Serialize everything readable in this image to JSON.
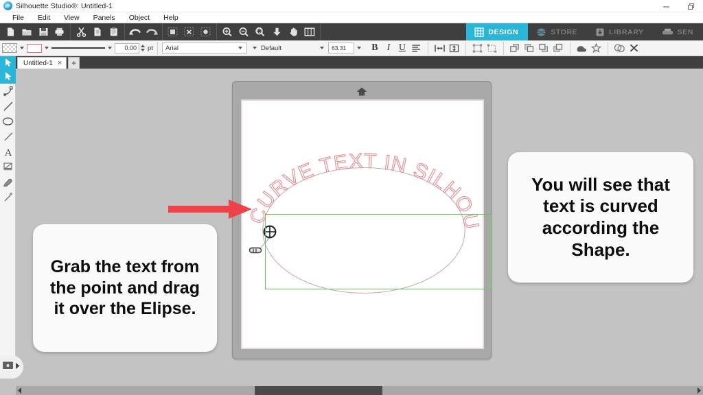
{
  "window": {
    "title": "Silhouette Studio®: Untitled-1",
    "logo_icon": "silhouette-logo-icon",
    "controls": [
      {
        "name": "minimize-button",
        "icon": "minimize-icon"
      },
      {
        "name": "restore-button",
        "icon": "restore-icon"
      }
    ]
  },
  "menubar": {
    "items": [
      {
        "label": "File"
      },
      {
        "label": "Edit"
      },
      {
        "label": "View"
      },
      {
        "label": "Panels"
      },
      {
        "label": "Object"
      },
      {
        "label": "Help"
      }
    ]
  },
  "toolbar_main": {
    "groups": [
      {
        "buttons": [
          {
            "name": "new-document-button",
            "icon": "new-file-icon"
          },
          {
            "name": "open-document-button",
            "icon": "folder-open-icon"
          },
          {
            "name": "save-button",
            "icon": "save-disk-icon"
          },
          {
            "name": "print-button",
            "icon": "printer-icon"
          }
        ]
      },
      {
        "buttons": [
          {
            "name": "cut-button",
            "icon": "scissors-icon"
          },
          {
            "name": "copy-button",
            "icon": "copy-icon"
          },
          {
            "name": "paste-button",
            "icon": "clipboard-icon"
          }
        ]
      },
      {
        "buttons": [
          {
            "name": "undo-button",
            "icon": "undo-arrow-icon"
          },
          {
            "name": "redo-button",
            "icon": "redo-arrow-icon"
          }
        ]
      },
      {
        "buttons": [
          {
            "name": "select-all-button",
            "icon": "select-all-icon"
          },
          {
            "name": "deselect-all-button",
            "icon": "deselect-all-icon"
          },
          {
            "name": "select-same-button",
            "icon": "select-same-icon"
          }
        ]
      },
      {
        "buttons": [
          {
            "name": "zoom-in-button",
            "icon": "zoom-in-icon"
          },
          {
            "name": "zoom-out-button",
            "icon": "zoom-out-icon"
          },
          {
            "name": "zoom-selection-button",
            "icon": "zoom-region-icon"
          },
          {
            "name": "fit-to-page-button",
            "icon": "fit-page-icon"
          },
          {
            "name": "pan-button",
            "icon": "hand-pan-icon"
          },
          {
            "name": "fit-to-window-button",
            "icon": "fit-window-icon"
          }
        ]
      }
    ],
    "mode_tabs": [
      {
        "label": "DESIGN",
        "icon": "grid-design-icon",
        "active": true
      },
      {
        "label": "STORE",
        "icon": "store-globe-icon",
        "active": false
      },
      {
        "label": "LIBRARY",
        "icon": "library-download-icon",
        "active": false
      },
      {
        "label": "SEN",
        "icon": "send-cutter-icon",
        "active": false
      }
    ],
    "accent_color": "#29b6d8",
    "background_color": "#3f3f3f"
  },
  "toolbar_secondary": {
    "fill_swatch": {
      "name": "fill-color-swatch",
      "icon": "transparent-checker-icon"
    },
    "line_swatch": {
      "name": "line-color-swatch",
      "color": "#ef6e80"
    },
    "line_style": {
      "name": "line-style-preview",
      "icon": "solid-line-icon"
    },
    "line_thickness": {
      "value": "0.00",
      "unit": "pt"
    },
    "font_family": {
      "value": "Arial"
    },
    "font_style": {
      "value": "Default"
    },
    "font_size": {
      "value": "63.31"
    },
    "text_buttons": [
      {
        "name": "bold-button",
        "label": "B"
      },
      {
        "name": "italic-button",
        "label": "I"
      },
      {
        "name": "underline-button",
        "label": "U"
      },
      {
        "name": "text-align-button",
        "icon": "align-left-icon"
      },
      {
        "name": "character-spacing-button",
        "icon": "character-spacing-icon"
      },
      {
        "name": "line-spacing-button",
        "icon": "line-spacing-icon"
      }
    ],
    "object_buttons": [
      {
        "name": "group-button",
        "icon": "group-icon"
      },
      {
        "name": "ungroup-button",
        "icon": "ungroup-icon"
      },
      {
        "name": "bring-to-front-button",
        "icon": "bring-to-front-icon"
      },
      {
        "name": "bring-forward-button",
        "icon": "bring-forward-icon"
      },
      {
        "name": "send-backward-button",
        "icon": "send-backward-icon"
      },
      {
        "name": "send-to-back-button",
        "icon": "send-to-back-icon"
      },
      {
        "name": "weld-button",
        "icon": "weld-icon"
      },
      {
        "name": "detach-lines-button",
        "icon": "star-detach-icon"
      },
      {
        "name": "offset-button",
        "icon": "offset-shapes-icon"
      },
      {
        "name": "delete-button",
        "icon": "close-x-icon"
      }
    ]
  },
  "tabstrip": {
    "active_tool_icon": "cursor-arrow-icon",
    "documents": [
      {
        "name": "Untitled-1",
        "close_label": "×"
      }
    ],
    "add_tab_label": "+"
  },
  "toolrail": {
    "tools": [
      {
        "name": "select-tool",
        "icon": "cursor-arrow-icon",
        "selected": true
      },
      {
        "name": "edit-points-tool",
        "icon": "edit-points-icon",
        "selected": false
      },
      {
        "name": "line-tool",
        "icon": "line-icon",
        "selected": false
      },
      {
        "name": "ellipse-tool",
        "icon": "ellipse-icon",
        "selected": false
      },
      {
        "name": "draw-tool",
        "icon": "pencil-icon",
        "selected": false
      },
      {
        "name": "text-tool",
        "icon": "text-a-icon",
        "selected": false
      },
      {
        "name": "knife-tool",
        "icon": "knife-icon",
        "selected": false
      },
      {
        "name": "eraser-tool",
        "icon": "eraser-icon",
        "selected": false
      },
      {
        "name": "eyedropper-tool",
        "icon": "eyedropper-icon",
        "selected": false
      }
    ]
  },
  "canvas": {
    "mat": {
      "name": "cutting-mat",
      "top_marker_icon": "mat-arrow-up-icon"
    },
    "page": {
      "name": "design-page",
      "border_color": "#f3dadd"
    },
    "artwork": {
      "curved_text": "CURVE TEXT IN SILHOUETTE",
      "text_color": "#e07f86",
      "path_shape": "ellipse",
      "path_color": "#c9a6a8",
      "control_point_icon": "text-path-control-point-icon",
      "drag_handle_icon": "text-drag-handle-icon"
    },
    "selection_box": {
      "name": "selection-bounding-box",
      "color": "#59c94d"
    },
    "pointer_annotation": {
      "name": "red-arrow-annotation",
      "color": "#f0404a"
    }
  },
  "callouts": {
    "left": "Grab the text from the point and drag it over the Elipse.",
    "right": "You will see that text is curved according the Shape."
  },
  "bottom": {
    "panel_toggle_icon": "library-panel-toggle-icon",
    "expand_arrow_icon": "expand-right-arrow-icon",
    "scrollbar": {
      "name": "horizontal-scrollbar",
      "left_arrow_icon": "scroll-left-arrow-icon",
      "right_arrow_icon": "scroll-right-arrow-icon"
    }
  }
}
